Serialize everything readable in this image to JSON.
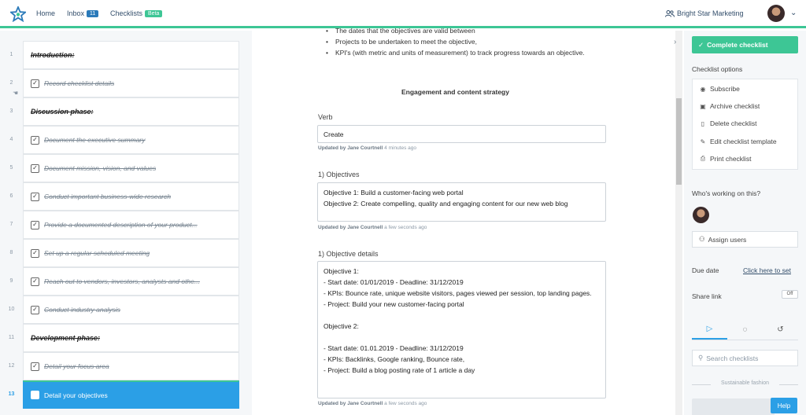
{
  "nav": {
    "home": "Home",
    "inbox": "Inbox",
    "inbox_count": "11",
    "checklists": "Checklists",
    "checklists_badge": "Beta",
    "org": "Bright Star Marketing"
  },
  "tasks": [
    {
      "num": "1",
      "label": "Introduction:",
      "heading": true
    },
    {
      "num": "2",
      "label": "Record checklist details",
      "done": true
    },
    {
      "num": "3",
      "label": "Discussion phase:",
      "heading": true
    },
    {
      "num": "4",
      "label": "Document the executive summary",
      "done": true
    },
    {
      "num": "5",
      "label": "Document mission, vision, and values",
      "done": true
    },
    {
      "num": "6",
      "label": "Conduct important business-wide research",
      "done": true
    },
    {
      "num": "7",
      "label": "Provide a documented description of your product...",
      "done": true
    },
    {
      "num": "8",
      "label": "Set up a regular scheduled meeting",
      "done": true
    },
    {
      "num": "9",
      "label": "Reach out to vendors, investors, analysts and othe...",
      "done": true
    },
    {
      "num": "10",
      "label": "Conduct industry analysis",
      "done": true
    },
    {
      "num": "11",
      "label": "Development phase:",
      "heading": true
    },
    {
      "num": "12",
      "label": "Detail your focus area",
      "done": true
    },
    {
      "num": "13",
      "label": "Detail your objectives",
      "done": false,
      "active": true
    }
  ],
  "content": {
    "bullets": [
      "The dates that the objectives are valid between",
      "Projects to be undertaken to meet the objective,",
      "KPI's (with metric and units of measurement) to track progress towards an objective."
    ],
    "section_title": "Engagement and content strategy",
    "verb_label": "Verb",
    "verb_value": "Create",
    "verb_meta_user": "Updated by Jane Courtnell",
    "verb_meta_time": "4 minutes ago",
    "obj_label": "1) Objectives",
    "obj_value": "Objective 1: Build a customer-facing web portal\nObjective 2: Create compelling, quality and engaging content for our new web blog",
    "obj_meta_user": "Updated by Jane Courtnell",
    "obj_meta_time": "a few seconds ago",
    "details_label": "1) Objective details",
    "details_value": "Objective 1:\n- Start date: 01/01/2019 - Deadline: 31/12/2019\n- KPIs: Bounce rate, unique website visitors, pages viewed per session, top landing pages.\n- Project: Build your new customer-facing portal\n\nObjective 2:\n\n- Start date: 01.01.2019 - Deadline: 31/12/2019\n- KPIs: Backlinks, Google ranking, Bounce rate,\n- Project: Build a blog posting rate of 1 article a day",
    "details_meta_user": "Updated by Jane Courtnell",
    "details_meta_time": "a few seconds ago"
  },
  "sidebar": {
    "complete": "Complete checklist",
    "options_title": "Checklist options",
    "options": [
      {
        "label": "Subscribe",
        "icon": "eye-icon"
      },
      {
        "label": "Archive checklist",
        "icon": "archive-icon"
      },
      {
        "label": "Delete checklist",
        "icon": "trash-icon"
      },
      {
        "label": "Edit checklist template",
        "icon": "pencil-icon"
      },
      {
        "label": "Print checklist",
        "icon": "printer-icon"
      }
    ],
    "working_title": "Who's working on this?",
    "assign": "Assign users",
    "due_label": "Due date",
    "due_link": "Click here to set",
    "share_label": "Share link",
    "share_toggle": "Off",
    "search_placeholder": "Search checklists",
    "group_label": "Sustainable fashion",
    "help": "Help"
  },
  "colors": {
    "accent_green": "#3dc695",
    "accent_blue": "#2b9fe6",
    "nav_text": "#334e6b"
  }
}
